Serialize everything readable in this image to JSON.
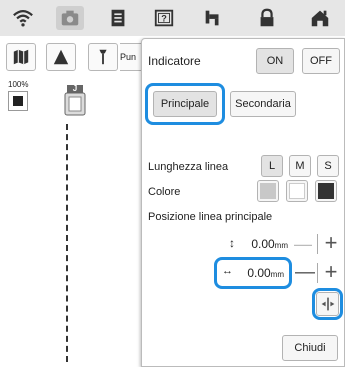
{
  "toolbar_icons": [
    "wifi-icon",
    "camera-icon",
    "document-icon",
    "help-icon",
    "thread-icon",
    "lock-icon",
    "home-icon"
  ],
  "zoom_label": "100%",
  "tool_tab_label": "Pun",
  "presser_foot_label": "J",
  "panel": {
    "indicator_label": "Indicatore",
    "on_label": "ON",
    "off_label": "OFF",
    "tab_primary": "Principale",
    "tab_secondary": "Secondaria",
    "line_length_label": "Lunghezza linea",
    "size_l": "L",
    "size_m": "M",
    "size_s": "S",
    "color_label": "Colore",
    "colors": [
      "#c8c8c8",
      "#ffffff",
      "#333333"
    ],
    "position_label": "Posizione linea principale",
    "vertical_value": "0.00",
    "horizontal_value": "0.00",
    "unit": "mm",
    "minus": "—",
    "plus": "+",
    "close_label": "Chiudi"
  },
  "highlight_color": "#1e8de0"
}
